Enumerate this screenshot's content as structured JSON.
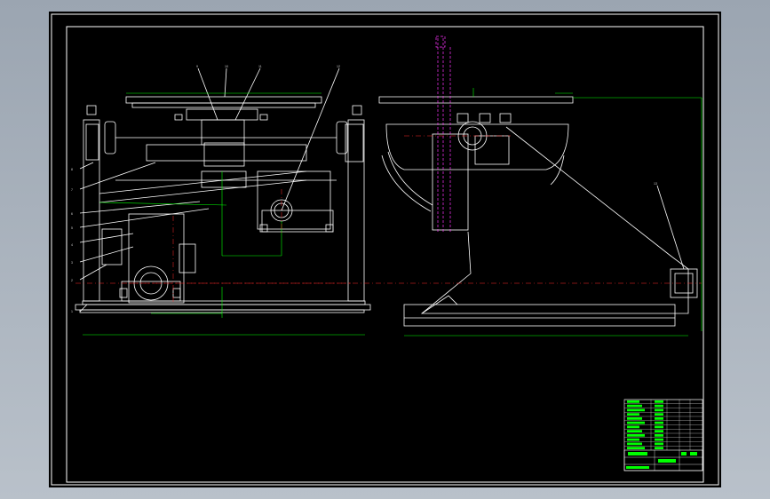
{
  "drawing": {
    "background": "#000000",
    "line_color": "#ffffff",
    "dimension_color": "#00ff00",
    "centerline_color": "#ff2a2a",
    "hidden_color": "#ff33ff"
  },
  "front_view": {
    "callouts": [
      "1",
      "2",
      "3",
      "4",
      "5",
      "6",
      "7",
      "8",
      "9",
      "10",
      "11",
      "12"
    ]
  },
  "side_view": {
    "callouts": [
      "13"
    ]
  },
  "title_block": {
    "parts_rows": 12,
    "fill_color": "#00ff00"
  }
}
